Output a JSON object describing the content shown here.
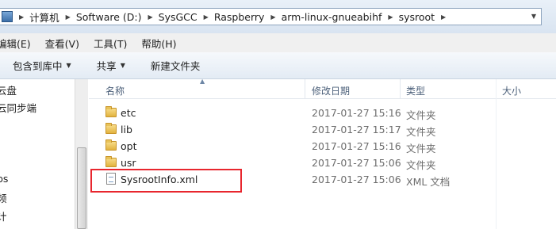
{
  "address": {
    "crumbs": [
      "计算机",
      "Software (D:)",
      "SysGCC",
      "Raspberry",
      "arm-linux-gnueabihf",
      "sysroot"
    ]
  },
  "menu": [
    "编辑(E)",
    "查看(V)",
    "工具(T)",
    "帮助(H)"
  ],
  "toolbar": {
    "include_library": "包含到库中",
    "share": "共享",
    "new_folder": "新建文件夹"
  },
  "nav": {
    "items": [
      "云盘",
      "云同步端",
      "ps",
      "频",
      "计"
    ]
  },
  "columns": {
    "name": "名称",
    "modified": "修改日期",
    "type": "类型",
    "size": "大小"
  },
  "files": [
    {
      "name": "etc",
      "modified": "2017-01-27 15:16",
      "type": "文件夹",
      "icon": "folder-icon"
    },
    {
      "name": "lib",
      "modified": "2017-01-27 15:17",
      "type": "文件夹",
      "icon": "folder-icon"
    },
    {
      "name": "opt",
      "modified": "2017-01-27 15:16",
      "type": "文件夹",
      "icon": "folder-icon"
    },
    {
      "name": "usr",
      "modified": "2017-01-27 15:06",
      "type": "文件夹",
      "icon": "folder-icon"
    },
    {
      "name": "SysrootInfo.xml",
      "modified": "2017-01-27 15:06",
      "type": "XML 文档",
      "icon": "xml-file-icon"
    }
  ],
  "highlight_color": "#e8262e"
}
